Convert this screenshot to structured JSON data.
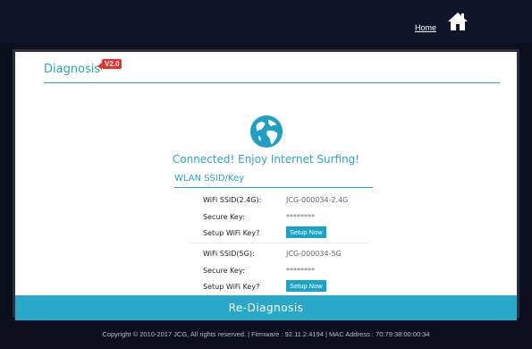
{
  "header": {
    "home_label": "Home"
  },
  "page": {
    "title": "Diagnosis",
    "version_badge": "V2.0",
    "status_text": "Connected! Enjoy Internet Surfing!"
  },
  "wlan": {
    "section_title": "WLAN SSID/Key",
    "band_24g": {
      "ssid_label": "WiFi SSID(2.4G):",
      "ssid_value": "JCG-000034-2.4G",
      "key_label": "Secure Key:",
      "key_value": "********",
      "setup_label": "Setup WiFi Key?",
      "setup_button": "Setup Now"
    },
    "band_5g": {
      "ssid_label": "WiFi SSID(5G):",
      "ssid_value": "JCG-000034-5G",
      "key_label": "Secure Key:",
      "key_value": "********",
      "setup_label": "Setup WiFi Key?",
      "setup_button": "Setup Now"
    }
  },
  "actions": {
    "rediagnosis_label": "Re-Diagnosis"
  },
  "footer": {
    "text": "Copyright © 2010-2017 JCG, All rights reserved.  |  Firmware : 92.11.2.4194  |  MAC Address : 70:79:38:00:00:34"
  },
  "colors": {
    "accent": "#2aa3c6",
    "badge": "#e2342a",
    "background": "#0d0f1e"
  },
  "icons": {
    "home": "home-icon",
    "globe": "globe-icon"
  }
}
